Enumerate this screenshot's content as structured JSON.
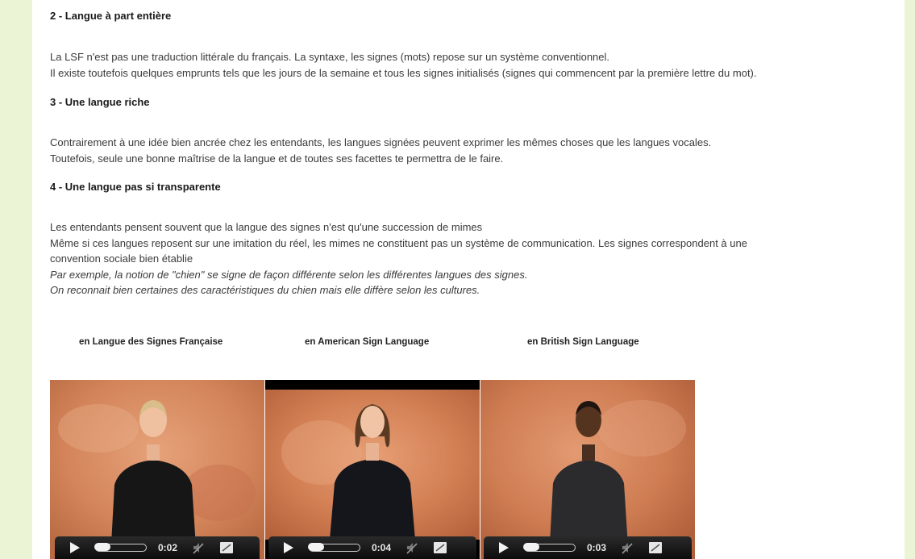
{
  "sections": [
    {
      "title": "2 - Langue à part entière",
      "lines": [
        "La LSF n'est pas une traduction littérale du français. La syntaxe, les signes (mots) repose sur un système conventionnel.",
        "Il existe toutefois quelques emprunts tels que les jours de la semaine et tous les signes initialisés (signes qui commencent par la première lettre du mot)."
      ]
    },
    {
      "title": "3 - Une langue riche",
      "lines": [
        "Contrairement à une idée bien ancrée chez les entendants, les langues signées peuvent exprimer les mêmes choses que les langues vocales.",
        "Toutefois, seule une bonne maîtrise de la langue et de toutes ses facettes te permettra de le faire."
      ]
    },
    {
      "title": "4 - Une langue pas si transparente",
      "lines": [
        "Les entendants pensent souvent que la langue des signes n'est qu'une succession de mimes",
        "Même si ces langues reposent sur une imitation du réel, les mimes ne constituent pas un système de communication. Les signes correspondent à une",
        "convention sociale bien établie"
      ],
      "italic_lines": [
        "Par exemple, la notion de \"chien\" se signe de façon différente selon les différentes langues des signes.",
        "On reconnait bien certaines des caractéristiques du chien mais elle diffère selon les cultures."
      ]
    }
  ],
  "videos": [
    {
      "caption": "en Langue des Signes Française",
      "time": "0:02",
      "progress": 0.05,
      "icons": {
        "play": "play-icon",
        "mute": "mute-icon",
        "fullscreen": "fullscreen-icon"
      }
    },
    {
      "caption": "en American Sign Language",
      "time": "0:04",
      "progress": 0.05,
      "icons": {
        "play": "play-icon",
        "mute": "mute-icon",
        "fullscreen": "fullscreen-icon"
      }
    },
    {
      "caption": "en British Sign Language",
      "time": "0:03",
      "progress": 0.05,
      "icons": {
        "play": "play-icon",
        "mute": "mute-icon",
        "fullscreen": "fullscreen-icon"
      }
    }
  ],
  "colors": {
    "page_background": "#ebf5d6",
    "content_background": "#ffffff",
    "video_backdrop": "#d98a5e",
    "controls_bar": "#1a1a1a"
  }
}
